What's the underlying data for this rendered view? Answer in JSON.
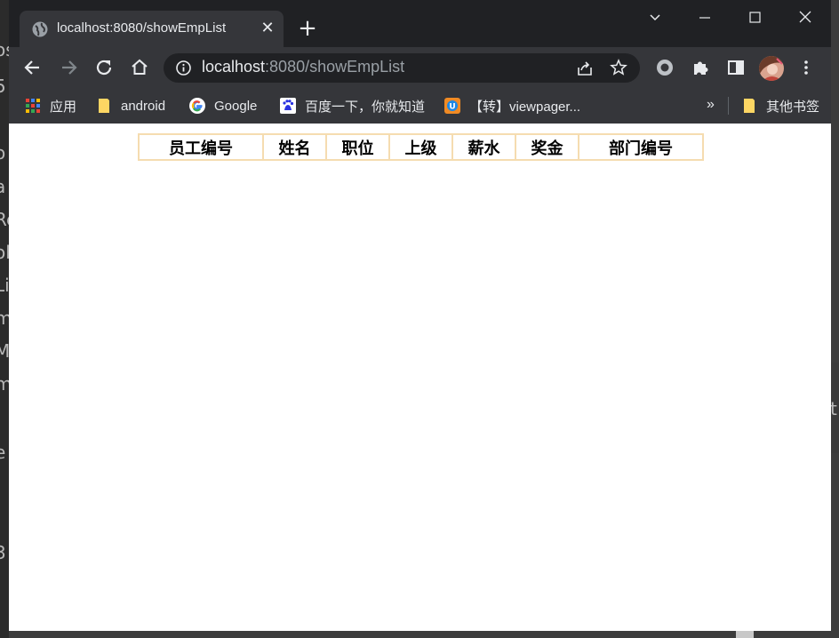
{
  "browser": {
    "tab": {
      "title": "localhost:8080/showEmpList",
      "favicon": "globe-icon"
    },
    "address_bar": {
      "host": "localhost",
      "rest": ":8080/showEmpList"
    },
    "bookmarks": [
      {
        "label": "应用",
        "icon": "apps-grid-icon"
      },
      {
        "label": "android",
        "icon": "folder-icon"
      },
      {
        "label": "Google",
        "icon": "google-icon"
      },
      {
        "label": "百度一下，你就知道",
        "icon": "baidu-icon"
      },
      {
        "label": "【转】viewpager...",
        "icon": "page-icon"
      }
    ],
    "bookmarks_more": "»",
    "other_bookmarks": "其他书签",
    "colors": {
      "frame": "#202124",
      "toolbar": "#35363a",
      "text": "#e8eaed",
      "muted": "#9aa0a6"
    }
  },
  "page": {
    "table": {
      "border_color": "#f5dcb0",
      "headers": [
        "员工编号",
        "姓名",
        "职位",
        "上级",
        "薪水",
        "奖金",
        "部门编号"
      ],
      "rows": []
    }
  },
  "background_app": {
    "left_fragments": [
      "os",
      "5",
      "o",
      "a",
      "Re",
      "ol",
      "Li",
      "m",
      "M",
      "m",
      "e",
      "3"
    ],
    "right_fragment": "t"
  }
}
